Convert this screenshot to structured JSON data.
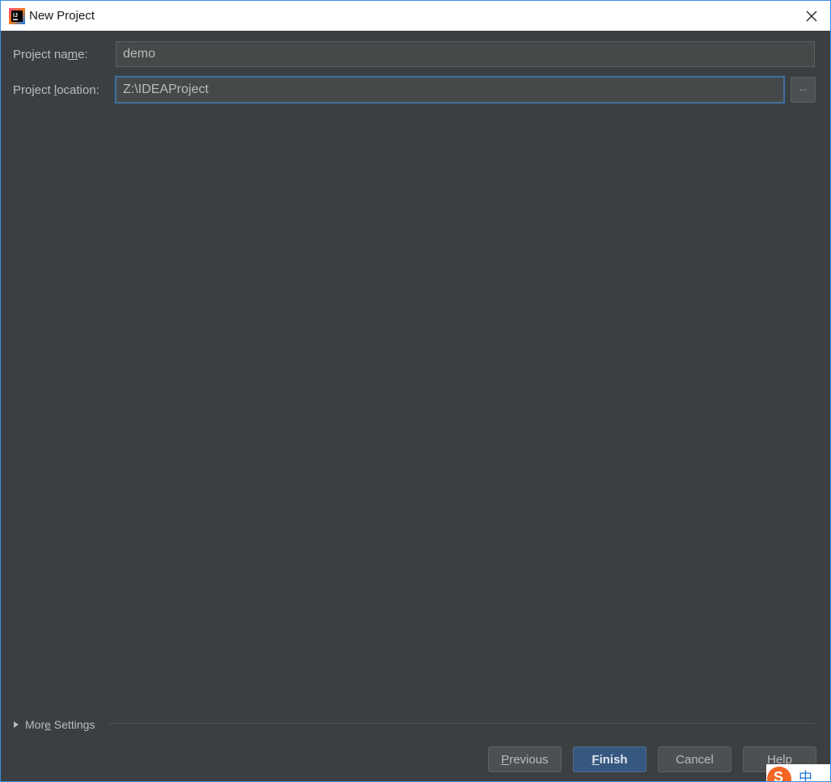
{
  "window": {
    "title": "New Project",
    "close_symbol": "✕",
    "icon": "intellij-idea-icon"
  },
  "form": {
    "project_name_label": "Project name:",
    "project_name_value": "demo",
    "project_location_label": "Project location:",
    "project_location_value": "Z:\\IDEAProject",
    "browse_label": "..."
  },
  "more_settings": {
    "label": "More Settings",
    "expanded": false
  },
  "buttons": {
    "previous": "Previous",
    "finish": "Finish",
    "cancel": "Cancel",
    "help": "Help"
  },
  "ime": {
    "logo": "sogou-ime-icon",
    "mode": "中"
  },
  "colors": {
    "background": "#3c3f41",
    "field": "#45494a",
    "focus_border": "#466d94",
    "default_button": "#365880"
  }
}
